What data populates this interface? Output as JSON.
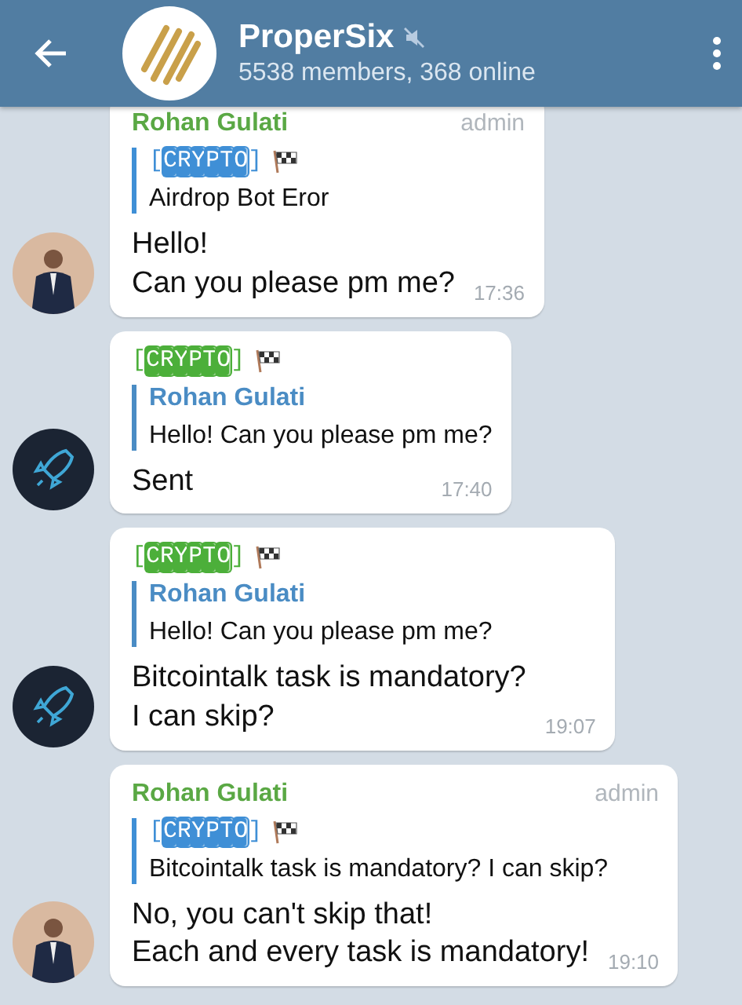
{
  "header": {
    "title": "ProperSix",
    "muted": true,
    "subtitle": "5538 members, 368 online"
  },
  "messages": [
    {
      "avatar": {
        "kind": "person"
      },
      "sender": {
        "name": "Rohan Gulati",
        "kind": "plain",
        "color": "#5aa844"
      },
      "badge": "admin",
      "reply": {
        "name": "[CRYPTO]",
        "kind": "boxed",
        "color": "#3f8fd6",
        "flag": true,
        "text": "Airdrop Bot Eror"
      },
      "text": "Hello!\nCan you please pm me?",
      "time": "17:36"
    },
    {
      "avatar": {
        "kind": "rocket"
      },
      "sender": {
        "name": "[CRYPTO]",
        "kind": "boxed",
        "color": "#4caf3a",
        "flag": true
      },
      "reply": {
        "name": "Rohan Gulati",
        "kind": "plain",
        "color": "#4a8cc4",
        "text": "Hello! Can you please pm me?"
      },
      "text": "Sent",
      "time": "17:40"
    },
    {
      "avatar": {
        "kind": "rocket"
      },
      "sender": {
        "name": "[CRYPTO]",
        "kind": "boxed",
        "color": "#4caf3a",
        "flag": true
      },
      "reply": {
        "name": "Rohan Gulati",
        "kind": "plain",
        "color": "#4a8cc4",
        "text": "Hello! Can you please pm me?"
      },
      "text": "Bitcointalk task is mandatory?\nI can skip?",
      "time": "19:07"
    },
    {
      "avatar": {
        "kind": "person"
      },
      "sender": {
        "name": "Rohan Gulati",
        "kind": "plain",
        "color": "#5aa844"
      },
      "badge": "admin",
      "reply": {
        "name": "[CRYPTO]",
        "kind": "boxed",
        "color": "#3f8fd6",
        "flag": true,
        "text": "Bitcointalk task is mandatory? I can skip?"
      },
      "text": "No, you can't skip that!\nEach and every task is mandatory!",
      "time": "19:10"
    }
  ]
}
